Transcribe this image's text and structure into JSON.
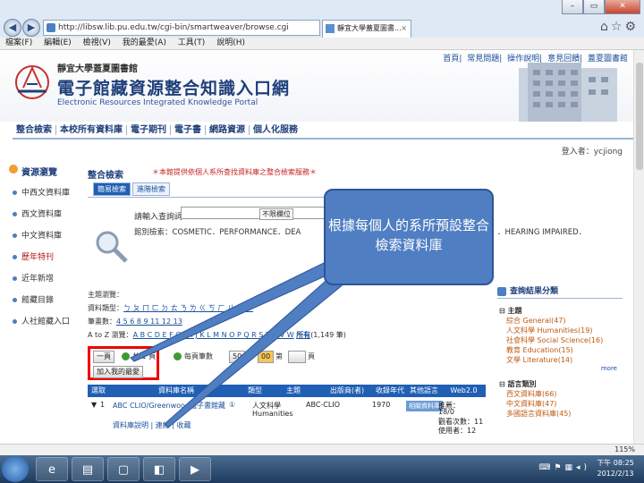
{
  "browser": {
    "url": "http://libsw.lib.pu.edu.tw/cgi-bin/smartweaver/browse.cgi",
    "tab_title": "靜宜大學蓋夏圖書...",
    "tab_close": "×",
    "menu": [
      "檔案(F)",
      "編輯(E)",
      "檢視(V)",
      "我的最愛(A)",
      "工具(T)",
      "說明(H)"
    ],
    "zoom": "115%"
  },
  "header": {
    "sub_title": "靜宜大學蓋夏圖書館",
    "title": "電子館藏資源整合知識入口網",
    "title_en": "Electronic Resources Integrated Knowledge Portal",
    "top_links": [
      "首頁",
      "常見問題",
      "操作說明",
      "意見回饋",
      "蓋夏圖書館"
    ]
  },
  "nav": {
    "items": [
      "整合檢索",
      "本校所有資料庫",
      "電子期刊",
      "電子書",
      "網路資源",
      "個人化服務"
    ]
  },
  "login": {
    "label": "登入者：",
    "user": "ycjiong"
  },
  "sidebar": {
    "title": "資源瀏覽",
    "items": [
      "中西文資料庫",
      "西文資料庫",
      "中文資料庫",
      "歷年特刊",
      "近年新增",
      "館藏目錄",
      "人社館藏入口"
    ]
  },
  "main": {
    "title": "整合檢索",
    "notice": "＊本館提供依個人系所查找資料庫之整合檢索服務＊",
    "subtabs": [
      "簡易檢索",
      "進階檢索"
    ],
    "search_label": "請輸入查詢詞：",
    "search_select": "不限欄位",
    "selected_prefix": "館別檢索：",
    "selected_items": "COSMETIC．PERFORMANCE．DEA",
    "selected_items_2": "．HEARING IMPAIRED．",
    "filters": {
      "line1": "主題瀏覽：",
      "line2_label": "資料類型：",
      "line2": "ㄅ ㄆ ㄇ ㄈ ㄉ ㄊ ㄋ ㄌ ㄍ ㄎ ㄏ ㄐ ㄑ ㄒ",
      "line3_label": "筆畫數：",
      "line3": "4 5 6 8 9 11 12 13",
      "line4_label": "A to Z 瀏覽：",
      "line4": "A B C D E F G H I J K L M N O P Q R S T U V W",
      "line4_all": "所有",
      "line4_count": "(1,149 筆)"
    },
    "toolbar": {
      "top_btn": "一頁",
      "next_label": "下頁",
      "page_size_label": "每頁筆數",
      "page_size": "50",
      "goto_label": "第",
      "goto_value": "00",
      "goto_unit": "頁",
      "bookmark_btn": "加入我的最愛",
      "page_info": "共 1 頁"
    },
    "table": {
      "headers": [
        "選取",
        "資料庫名稱",
        "類型",
        "主題",
        "出版商(者)",
        "收錄年代",
        "其他語言",
        "Web2.0"
      ],
      "rows": [
        {
          "no": "1",
          "title": "ABC CLIO/Greenwood電子書館藏",
          "type": "①",
          "subject": "人文科學",
          "subject2": "Humanities",
          "publisher": "ABC-CLIO",
          "year": "1970",
          "badge": "相關資料庫",
          "web1": "推薦：",
          "web2": "18/0",
          "web3": "觀看次數：11",
          "web4": "使用者：12",
          "links": "資料庫說明 | 連線 | 收藏"
        }
      ]
    }
  },
  "rpanel": {
    "title": "查詢結果分類",
    "group1": "主題",
    "group1_items": [
      "綜合 General(47)",
      "人文科學 Humanities(19)",
      "社會科學 Social Science(16)",
      "教育 Education(15)",
      "文學 Literature(14)"
    ],
    "more": "more",
    "group2": "語言類別",
    "group2_items": [
      "西文資料庫(66)",
      "中文資料庫(47)",
      "多國語言資料庫(45)"
    ]
  },
  "callout": {
    "text": "根據每個人的系所預設整合檢索資料庫"
  },
  "taskbar": {
    "clock_time": "下午 08:25",
    "clock_date": "2012/2/13"
  },
  "colors": {
    "accent": "#1f5fb4",
    "highlight": "#e00000",
    "callout": "#4f7ec2"
  }
}
